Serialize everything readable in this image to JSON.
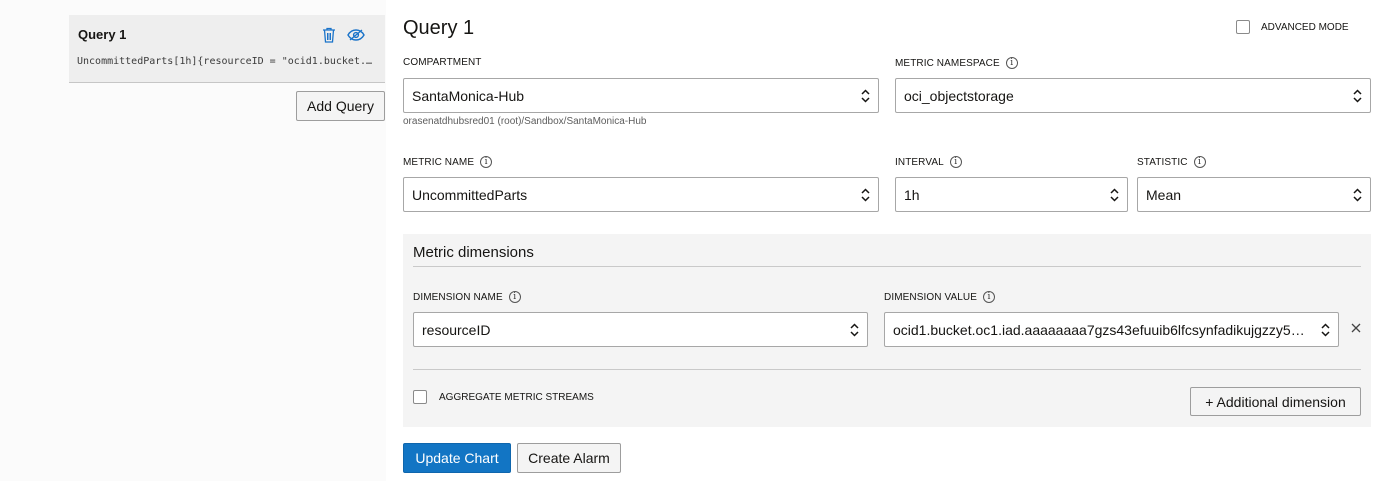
{
  "sidebar": {
    "query_card": {
      "title": "Query 1",
      "expression": "UncommittedParts[1h]{resourceID = \"ocid1.bucket.…",
      "delete_icon": "trash-icon",
      "visibility_icon": "eye-icon"
    },
    "add_query_label": "Add Query"
  },
  "main": {
    "title": "Query 1",
    "advanced_mode_label": "ADVANCED MODE",
    "compartment": {
      "label": "COMPARTMENT",
      "value": "SantaMonica-Hub",
      "path": "orasenatdhubsred01 (root)/Sandbox/SantaMonica-Hub"
    },
    "metric_namespace": {
      "label": "METRIC NAMESPACE",
      "value": "oci_objectstorage"
    },
    "metric_name": {
      "label": "METRIC NAME",
      "value": "UncommittedParts"
    },
    "interval": {
      "label": "INTERVAL",
      "value": "1h"
    },
    "statistic": {
      "label": "STATISTIC",
      "value": "Mean"
    },
    "dimensions": {
      "title": "Metric dimensions",
      "name_label": "DIMENSION NAME",
      "value_label": "DIMENSION VALUE",
      "name_value": "resourceID",
      "value_value": "ocid1.bucket.oc1.iad.aaaaaaaa7gzs43efuuib6lfcsynfadikujgzzy57…",
      "aggregate_label": "AGGREGATE METRIC STREAMS",
      "additional_label": "+ Additional dimension"
    },
    "update_chart_label": "Update Chart",
    "create_alarm_label": "Create Alarm"
  },
  "colors": {
    "primary": "#1275c4",
    "icon_blue": "#1a73c9"
  }
}
